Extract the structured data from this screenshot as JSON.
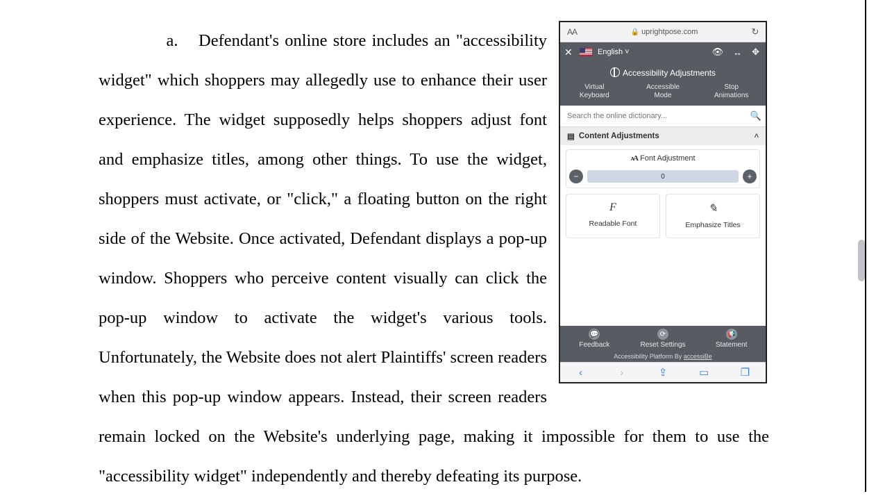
{
  "document": {
    "list_label": "a.",
    "body_before_image": "Defendant's online store includes an \"accessibility widget\" which shoppers may allegedly use to enhance their user experience. The widget supposedly helps shoppers adjust font and emphasize titles, among other things. To use the widget, shoppers must activate, or \"click,\" a floating button on the right side of the Website. Once activated, Defendant displays a pop-up window. Shoppers who perceive content visually can click the pop-up window to activate the widget's various tools. Unfortunately, the Website does not alert Plaintiffs' screen readers when this pop-up window appears. Instead, their screen readers remain locked on ",
    "body_after_image": "the Website's underlying page, making it impossible for them to use the \"accessibility widget\" independently and thereby defeating its purpose."
  },
  "phone": {
    "safari": {
      "text_size_label": "AA",
      "domain": "uprightpose.com"
    },
    "panel": {
      "language": "English",
      "title": "Accessibility Adjustments",
      "modes": [
        {
          "line1": "Virtual",
          "line2": "Keyboard"
        },
        {
          "line1": "Accessible",
          "line2": "Mode"
        },
        {
          "line1": "Stop",
          "line2": "Animations"
        }
      ],
      "search_placeholder": "Search the online dictionary...",
      "section_label": "Content Adjustments",
      "font_adjustment_label": "Font Adjustment",
      "font_value": "0",
      "tile_readable": "Readable Font",
      "tile_emphasize": "Emphasize Titles",
      "footer": {
        "feedback": "Feedback",
        "reset": "Reset Settings",
        "statement": "Statement",
        "credit_prefix": "Accessibility Platform By ",
        "credit_link": "accessiBe"
      }
    }
  }
}
